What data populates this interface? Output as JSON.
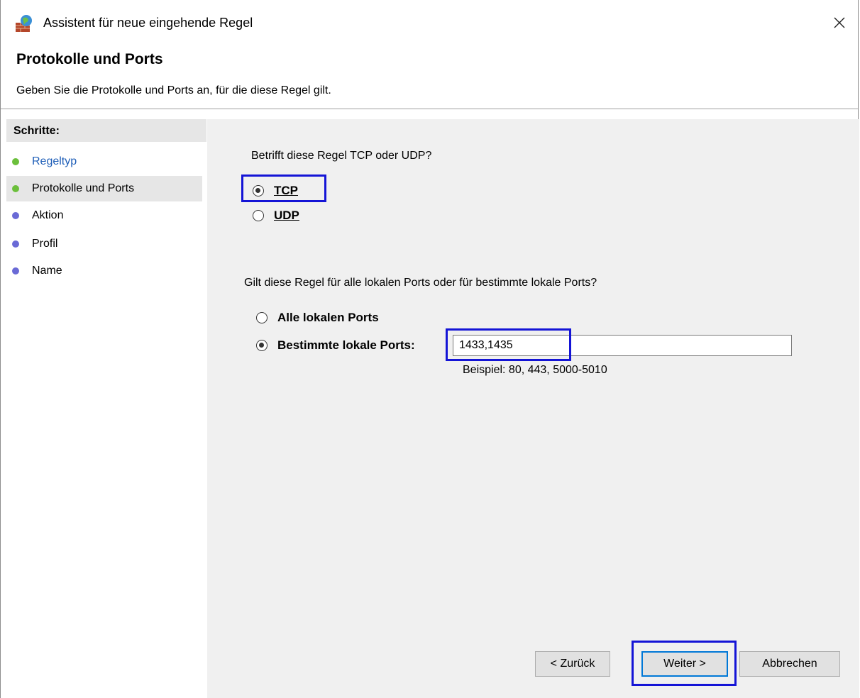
{
  "window": {
    "title": "Assistent für neue eingehende Regel",
    "close_glyph": "✕"
  },
  "header": {
    "title": "Protokolle und Ports",
    "description": "Geben Sie die Protokolle und Ports an, für die diese Regel gilt."
  },
  "sidebar": {
    "heading": "Schritte:",
    "steps": [
      {
        "label": "Regeltyp",
        "state": "done",
        "dot_color": "#6bbf3b"
      },
      {
        "label": "Protokolle und Ports",
        "state": "current",
        "dot_color": "#6bbf3b"
      },
      {
        "label": "Aktion",
        "state": "pending",
        "dot_color": "#6a6ad6"
      },
      {
        "label": "Profil",
        "state": "pending",
        "dot_color": "#6a6ad6"
      },
      {
        "label": "Name",
        "state": "pending",
        "dot_color": "#6a6ad6"
      }
    ]
  },
  "protocol": {
    "question": "Betrifft diese Regel TCP oder UDP?",
    "options": [
      {
        "label": "TCP",
        "checked": true
      },
      {
        "label": "UDP",
        "checked": false
      }
    ]
  },
  "ports": {
    "question": "Gilt diese Regel für alle lokalen Ports oder für bestimmte lokale Ports?",
    "all_label": "Alle lokalen Ports",
    "specific_label": "Bestimmte lokale Ports:",
    "selected": "specific",
    "value": "1433,1435",
    "example": "Beispiel: 80, 443, 5000-5010"
  },
  "buttons": {
    "back": "< Zurück",
    "next": "Weiter >",
    "cancel": "Abbrechen"
  },
  "colors": {
    "highlight": "#1414d6",
    "link": "#1f5fb8",
    "panel": "#f0f0f0"
  }
}
